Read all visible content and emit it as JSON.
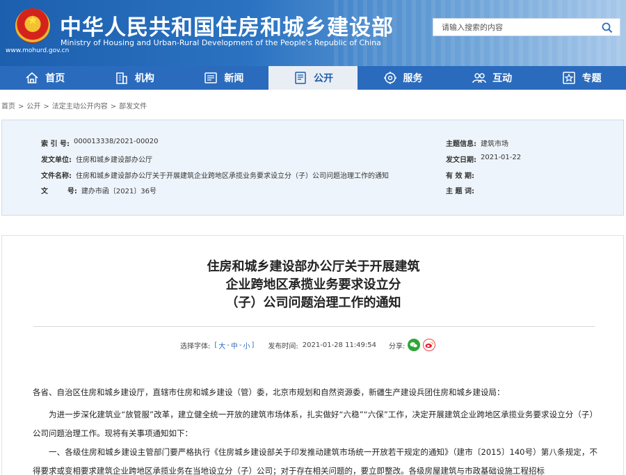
{
  "header": {
    "title": "中华人民共和国住房和城乡建设部",
    "subtitle": "Ministry of Housing and Urban-Rural Development of the People's Republic of China",
    "site_url": "www.mohurd.gov.cn",
    "search_placeholder": "请输入搜索的内容"
  },
  "nav": [
    {
      "label": "首页",
      "icon": "home-icon"
    },
    {
      "label": "机构",
      "icon": "building-icon"
    },
    {
      "label": "新闻",
      "icon": "news-icon"
    },
    {
      "label": "公开",
      "icon": "document-icon",
      "active": true
    },
    {
      "label": "服务",
      "icon": "service-icon"
    },
    {
      "label": "互动",
      "icon": "people-icon"
    },
    {
      "label": "专题",
      "icon": "star-icon"
    }
  ],
  "breadcrumb": [
    "首页",
    "公开",
    "法定主动公开内容",
    "部发文件"
  ],
  "info": {
    "index_label": "索 引 号:",
    "index_value": "000013338/2021-00020",
    "issuer_label": "发文单位:",
    "issuer_value": "住房和城乡建设部办公厅",
    "filename_label": "文件名称:",
    "filename_value": "住房和城乡建设部办公厅关于开展建筑企业跨地区承揽业务要求设立分（子）公司问题治理工作的通知",
    "docno_label": "文        号:",
    "docno_value": "建办市函〔2021〕36号",
    "topic_label": "主题信息:",
    "topic_value": "建筑市场",
    "date_label": "发文日期:",
    "date_value": "2021-01-22",
    "validity_label": "有 效 期:",
    "validity_value": "",
    "keywords_label": "主 题 词:",
    "keywords_value": ""
  },
  "article": {
    "title_line1": "住房和城乡建设部办公厅关于开展建筑",
    "title_line2": "企业跨地区承揽业务要求设立分",
    "title_line3": "（子）公司问题治理工作的通知",
    "font_label": "选择字体:",
    "font_open": "[",
    "font_large": "大",
    "font_medium": "中",
    "font_small": "小",
    "font_close": "]",
    "font_sep": "-",
    "publish_label": "发布时间:",
    "publish_time": "2021-01-28 11:49:54",
    "share_label": "分享:",
    "para1": "各省、自治区住房和城乡建设厅，直辖市住房和城乡建设（管）委，北京市规划和自然资源委，新疆生产建设兵团住房和城乡建设局：",
    "para2": "为进一步深化建筑业“放管服”改革，建立健全统一开放的建筑市场体系，扎实做好“六稳”“六保”工作，决定开展建筑企业跨地区承揽业务要求设立分（子）公司问题治理工作。现将有关事项通知如下：",
    "para3": "一、各级住房和城乡建设主管部门要严格执行《住房城乡建设部关于印发推动建筑市场统一开放若干规定的通知》（建市〔2015〕140号）第八条规定，不得要求或变相要求建筑企业跨地区承揽业务在当地设立分（子）公司；对于存在相关问题的，要立即整改。各级房屋建筑与市政基础设施工程招标"
  }
}
